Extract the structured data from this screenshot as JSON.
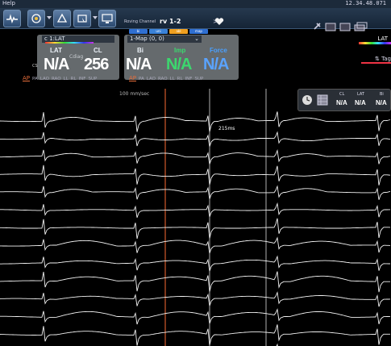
{
  "system_bar": {
    "menu_label": "Help",
    "clock_text": "12.34.48.071"
  },
  "toolbar": {
    "roving_label": "Roving Channel",
    "roving_value": "rv 1-2",
    "chevron": ">",
    "chips": [
      {
        "label": "bi",
        "color": "#2f6fd1"
      },
      {
        "label": "uni",
        "color": "#3a82d8"
      },
      {
        "label": "abl",
        "color": "#f0a020"
      },
      {
        "label": "map",
        "color": "#2f6fd1"
      }
    ]
  },
  "lat_panel": {
    "title": "c 1:LAT",
    "label_lat": "LAT",
    "label_cl": "CL",
    "lat_value": "N/A",
    "cl_value": "256",
    "faint_label": "Cdiag",
    "views": [
      "AP",
      "PA",
      "LAO",
      "RAO",
      "LL",
      "RL",
      "INF",
      "SUP"
    ],
    "active_view": "AP"
  },
  "map_panel": {
    "title": "1-Map (0, 0)",
    "label_bi": "Bi",
    "label_imp": "Imp",
    "label_force": "Force",
    "bi_value": "N/A",
    "imp_value": "N/A",
    "force_value": "N/A",
    "views": [
      "AP",
      "PA",
      "LAO",
      "RAO",
      "LL",
      "RL",
      "INF",
      "SUP"
    ],
    "active_view": "AP"
  },
  "small_panel": {
    "cl_label": "CL",
    "lat_label": "LAT",
    "bi_label": "Bi",
    "cl_value": "N/A",
    "lat_value": "N/A",
    "bi_value": "N/A"
  },
  "right_side": {
    "top_label": "LAT",
    "sub_label": "Tag"
  },
  "left_mini": "CS",
  "traces": {
    "speed_label": "100 mm/sec",
    "measure_label": "215ms",
    "num_channels": 14,
    "beat_times_sec": [
      0.11,
      0.34,
      0.52,
      0.69,
      0.94
    ],
    "cursor_times_sec": [
      0.41,
      0.52,
      0.66
    ]
  },
  "colors": {
    "trace": "#f2f2f2",
    "cursor": "#d05a2a",
    "cursor_white": "#dddddd",
    "lat_value": "#ffffff",
    "imp_value": "#3cd76e",
    "force_value": "#5aa3ff",
    "label_blue": "#4aa0ff",
    "label_green": "#3cd76e"
  }
}
